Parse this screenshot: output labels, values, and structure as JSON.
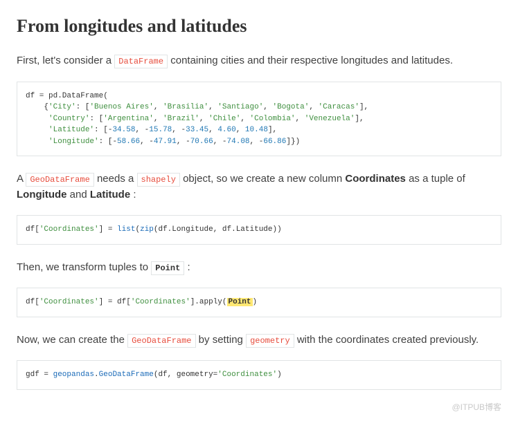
{
  "heading": "From longitudes and latitudes",
  "p1": {
    "t1": "First, let's consider a ",
    "code1": "DataFrame",
    "t2": " containing cities and their respective longitudes and latitudes."
  },
  "code1_parts": {
    "l1_a": "df = pd.DataFrame(",
    "l2_a": "    {",
    "city_key": "'City'",
    "sep_colon_arr": ": [",
    "city1": "'Buenos Aires'",
    "city2": "'Brasilia'",
    "city3": "'Santiago'",
    "city4": "'Bogota'",
    "city5": "'Caracas'",
    "close_arr_c": "],",
    "country_key": "'Country'",
    "country1": "'Argentina'",
    "country2": "'Brazil'",
    "country3": "'Chile'",
    "country4": "'Colombia'",
    "country5": "'Venezuela'",
    "lat_key": "'Latitude'",
    "lat_open": ": [-",
    "lat1": "34.58",
    "lat2": "15.78",
    "lat3": "33.45",
    "lat4": "4.60",
    "lat5": "10.48",
    "lon_key": "'Longitude'",
    "lon1": "58.66",
    "lon2": "47.91",
    "lon3": "70.66",
    "lon4": "74.08",
    "lon5": "66.86",
    "lon_close": "]})",
    "comma_sp": ", ",
    "comma_neg": ", -"
  },
  "p2": {
    "t1": "A ",
    "code1": "GeoDataFrame",
    "t2": " needs a ",
    "code2": "shapely",
    "t3": " object, so we create a new column ",
    "bold1": "Coordinates",
    "t4": " as a tuple of ",
    "bold2": "Longitude",
    "t5": " and ",
    "bold3": "Latitude",
    "t6": " :"
  },
  "code2_parts": {
    "a": "df[",
    "coord": "'Coordinates'",
    "b": "] = ",
    "list": "list",
    "c": "(",
    "zip": "zip",
    "d": "(df.Longitude, df.Latitude))"
  },
  "p3": {
    "t1": "Then, we transform tuples to ",
    "hl": "Point",
    "t2": " :"
  },
  "code3_parts": {
    "a": "df[",
    "coord": "'Coordinates'",
    "b": "] = df[",
    "c": "].apply(",
    "point": "Point",
    "d": ")"
  },
  "p4": {
    "t1": "Now, we can create the ",
    "code1": "GeoDataFrame",
    "t2": " by setting ",
    "code2": "geometry",
    "t3": " with the coordinates created previously."
  },
  "code4_parts": {
    "a": "gdf = ",
    "mod": "geopandas",
    "dot": ".",
    "cls": "GeoDataFrame",
    "b": "(df, geometry=",
    "coord": "'Coordinates'",
    "c": ")"
  },
  "watermark": "@ITPUB博客"
}
